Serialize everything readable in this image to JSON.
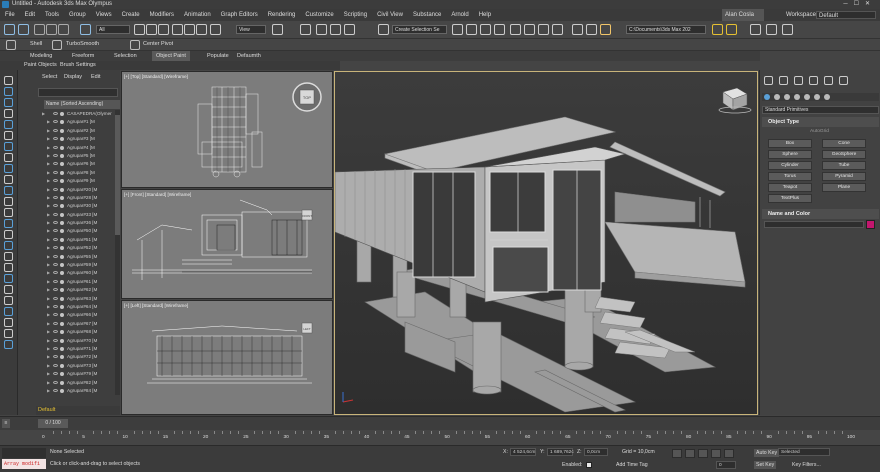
{
  "window": {
    "title": "Untitled - Autodesk 3ds Max Olympus",
    "user": "Alan Cosla",
    "workspace_label": "Workspaces:",
    "workspace_value": "Default"
  },
  "menu": [
    "File",
    "Edit",
    "Tools",
    "Group",
    "Views",
    "Create",
    "Modifiers",
    "Animation",
    "Graph Editors",
    "Rendering",
    "Customize",
    "Scripting",
    "Civil View",
    "Substance",
    "Arnold",
    "Help"
  ],
  "toolbar": {
    "selection_filter": "All",
    "reference_coord": "View",
    "named_selection": "Create Selection Se",
    "path": "C:\\Documents\\3ds Max 202"
  },
  "toolbar2": {
    "shell": "Shell",
    "turbosmooth": "TurboSmooth",
    "center_pivot": "Center Pivot"
  },
  "ribbon": {
    "tabs": [
      "Modeling",
      "Freeform",
      "Selection",
      "Object Paint",
      "Populate",
      "Defaumth"
    ],
    "active_tab": "Object Paint",
    "sub": [
      "Paint Objects",
      "Brush Settings"
    ]
  },
  "explorer": {
    "tabs": [
      "Select",
      "Display",
      "Edit"
    ],
    "header": "Name (Sorted Ascending)",
    "rows": [
      "CASAPEDRA(Olymer",
      "Agrupar#1 [M",
      "Agrupar#2 [M",
      "Agrupar#3 [M",
      "Agrupar#4 [M",
      "Agrupar#5 [M",
      "Agrupar#6 [M",
      "Agrupar#8 [M",
      "Agrupar#9 [M",
      "Agrupar#20 [M",
      "Agrupar#28 [M",
      "Agrupar#30 [M",
      "Agrupar#33 [M",
      "Agrupar#36 [M",
      "Agrupar#50 [M",
      "Agrupar#51 [M",
      "Agrupar#52 [M",
      "Agrupar#55 [M",
      "Agrupar#59 [M",
      "Agrupar#60 [M",
      "Agrupar#61 [M",
      "Agrupar#62 [M",
      "Agrupar#63 [M",
      "Agrupar#64 [M",
      "Agrupar#66 [M",
      "Agrupar#67 [M",
      "Agrupar#68 [M",
      "Agrupar#70 [M",
      "Agrupar#71 [M",
      "Agrupar#72 [M",
      "Agrupar#73 [M",
      "Agrupar#79 [M",
      "Agrupar#82 [M",
      "Agrupar#84 [M",
      "Agrupar#90 [M",
      "Agrupar#91 [M"
    ],
    "layer": "Default"
  },
  "viewports": {
    "top": "[+] [Top] [Standard] [Wireframe]",
    "front": "[+] [Front] [Standard] [Wireframe]",
    "left": "[+] [Left] [Standard] [Wireframe]",
    "perspective": "[+] [Perspective] [Standard] [Default Shading]",
    "cube_top": "TOP",
    "cube_front": "FRONT",
    "cube_left": "LEFT"
  },
  "command_panel": {
    "dropdown": "Standard Primitives",
    "rollout_type": "Object Type",
    "autogrid": "AutoGrid",
    "buttons": [
      "Box",
      "Cone",
      "Sphere",
      "GeoSphere",
      "Cylinder",
      "Tube",
      "Torus",
      "Pyramid",
      "Teapot",
      "Plane",
      "TextPlus"
    ],
    "rollout_name": "Name and Color",
    "swatch_color": "#c2166e"
  },
  "timeline": {
    "frame": "0 / 100",
    "ticks": [
      "0",
      "5",
      "10",
      "15",
      "20",
      "25",
      "30",
      "35",
      "40",
      "45",
      "50",
      "55",
      "60",
      "65",
      "70",
      "75",
      "80",
      "85",
      "90",
      "95",
      "100"
    ]
  },
  "status": {
    "maxscript": "Array modifi",
    "selection": "None Selected",
    "prompt": "Click or click-and-drag to select objects",
    "x_label": "X:",
    "x_value": "4 524,6cm",
    "y_label": "Y:",
    "y_value": "1 689,762c",
    "z_label": "Z:",
    "z_value": "0,0cm",
    "grid": "Grid = 10,0cm",
    "enabled": "Enabled:",
    "add_time_tag": "Add Time Tag",
    "auto_key": "Auto Key",
    "set_key": "Set Key",
    "key_mode": "Selected",
    "key_filters": "Key Filters...",
    "frame_field": "0"
  }
}
